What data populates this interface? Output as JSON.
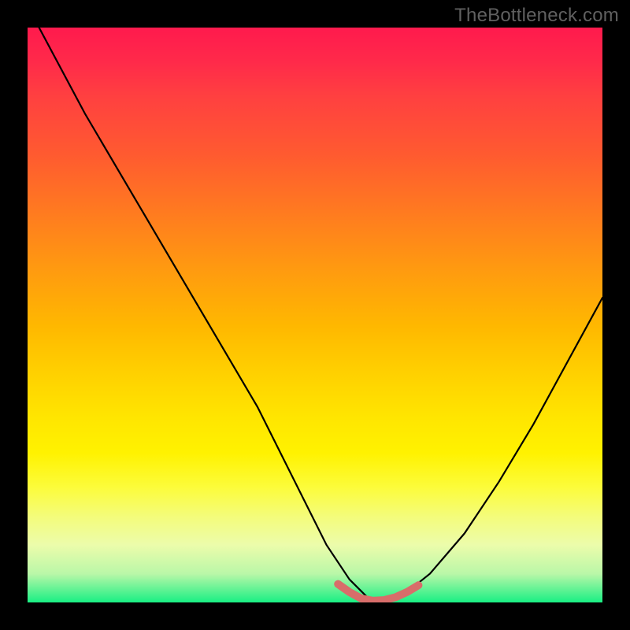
{
  "watermark": "TheBottleneck.com",
  "chart_data": {
    "type": "line",
    "title": "",
    "xlabel": "",
    "ylabel": "",
    "xlim": [
      0,
      100
    ],
    "ylim": [
      0,
      100
    ],
    "series": [
      {
        "name": "primary-curve",
        "x": [
          2,
          10,
          20,
          30,
          40,
          48,
          52,
          56,
          59,
          62,
          65,
          70,
          76,
          82,
          88,
          94,
          100
        ],
        "y": [
          100,
          85,
          68,
          51,
          34,
          18,
          10,
          4,
          1,
          0,
          1,
          5,
          12,
          21,
          31,
          42,
          53
        ]
      },
      {
        "name": "highlight-valley",
        "x": [
          54,
          56,
          58,
          60,
          62,
          64,
          66,
          68
        ],
        "y": [
          3.2,
          1.8,
          0.7,
          0.3,
          0.4,
          0.9,
          1.8,
          3.0
        ]
      }
    ],
    "annotations": []
  },
  "colors": {
    "curve": "#000000",
    "highlight": "#d86d6a",
    "background_top": "#ff1a4d",
    "background_bottom": "#19ef84",
    "frame": "#000000"
  }
}
